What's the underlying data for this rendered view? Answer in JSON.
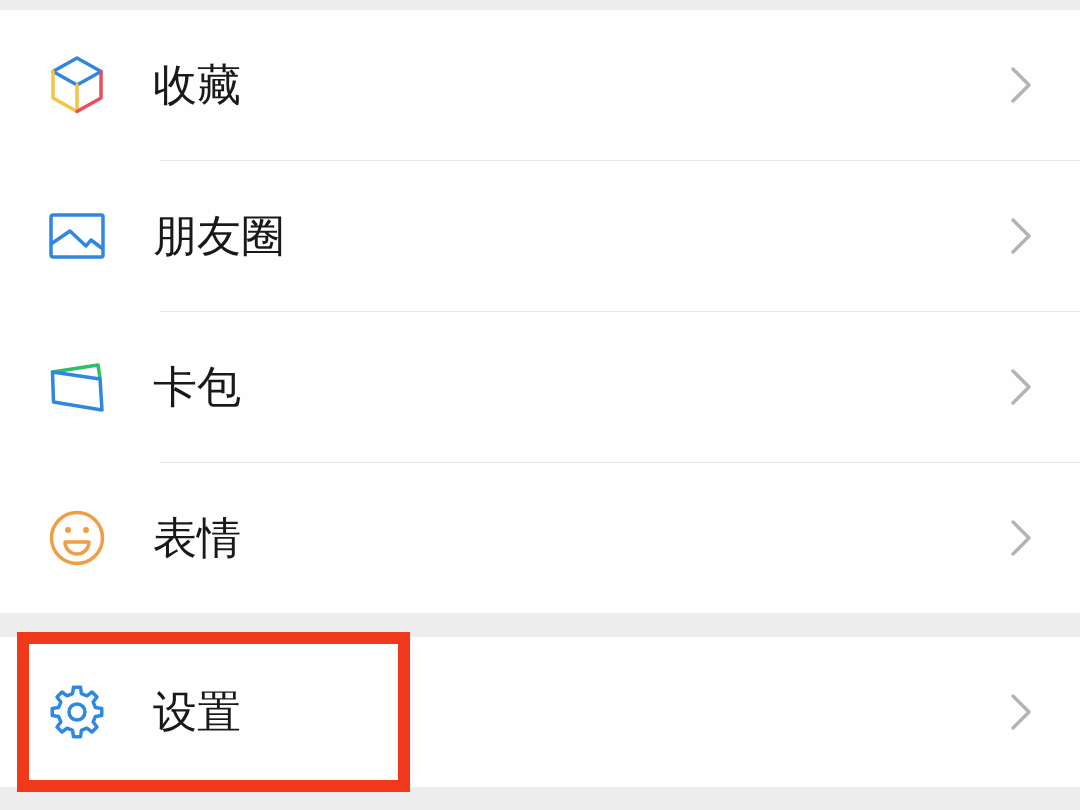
{
  "groups": [
    {
      "items": [
        {
          "label": "收藏",
          "highlighted": false
        },
        {
          "label": "朋友圈",
          "highlighted": false
        },
        {
          "label": "卡包",
          "highlighted": false
        },
        {
          "label": "表情",
          "highlighted": false
        }
      ]
    },
    {
      "items": [
        {
          "label": "设置",
          "highlighted": true
        }
      ]
    }
  ]
}
